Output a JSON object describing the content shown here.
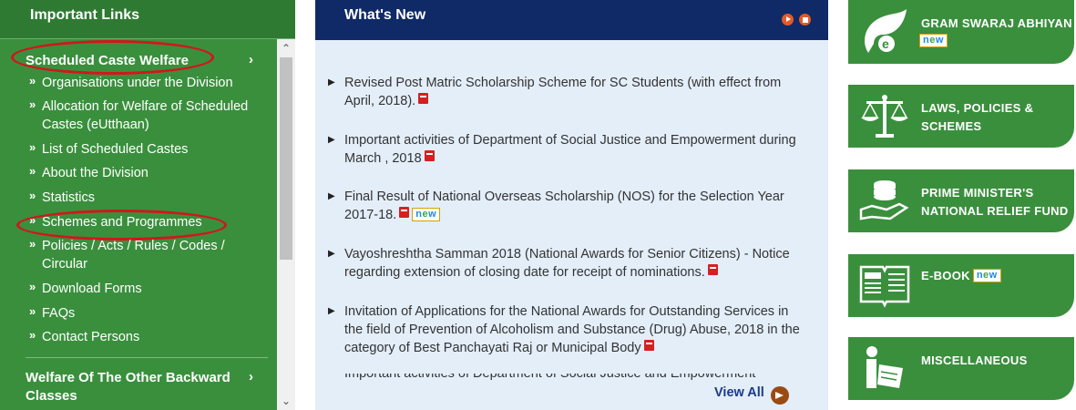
{
  "left_panel": {
    "title": "Important Links",
    "scroll_up": "⌃",
    "scroll_down": "⌄",
    "section1": {
      "label": "Scheduled Caste Welfare",
      "chevron": "›",
      "items": [
        {
          "label": "Organisations under the Division"
        },
        {
          "label": "Allocation for Welfare of Scheduled Castes (eUtthaan)"
        },
        {
          "label": "List of Scheduled Castes"
        },
        {
          "label": "About the Division"
        },
        {
          "label": "Statistics"
        },
        {
          "label": "Schemes and Programmes"
        },
        {
          "label": "Policies / Acts / Rules / Codes / Circular"
        },
        {
          "label": "Download Forms"
        },
        {
          "label": "FAQs"
        },
        {
          "label": "Contact Persons"
        }
      ]
    },
    "section2": {
      "label": "Welfare Of The Other Backward Classes",
      "chevron": "›"
    },
    "highlight_color": "#d2161c"
  },
  "whats_new": {
    "title": "What's New",
    "items": [
      {
        "text": "Revised Post Matric Scholarship Scheme for SC Students (with effect from April, 2018).",
        "pdf": true,
        "new": false
      },
      {
        "text": "Important activities of Department of Social Justice and Empowerment during March , 2018",
        "pdf": true,
        "new": false
      },
      {
        "text": "Final Result of National Overseas Scholarship (NOS) for the Selection Year 2017-18.",
        "pdf": true,
        "new": true
      },
      {
        "text": "Vayoshreshtha Samman 2018 (National Awards for Senior Citizens) - Notice regarding extension of closing date for receipt of nominations.",
        "pdf": true,
        "new": false
      },
      {
        "text": "Invitation of Applications for the National Awards for Outstanding Services in the field of Prevention of Alcoholism and Substance (Drug) Abuse, 2018 in the category of Best Panchayati Raj or Municipal Body",
        "pdf": true,
        "new": false
      },
      {
        "text": "Important activities of Department of Social Justice and Empowerment during",
        "pdf": false,
        "new": false
      }
    ],
    "new_badge": "new",
    "view_all": "View All"
  },
  "tiles": [
    {
      "label": "GRAM SWARAJ ABHIYAN",
      "new": true,
      "icon": "gram-swaraj-logo-icon"
    },
    {
      "label": "LAWS, POLICIES & SCHEMES",
      "new": false,
      "icon": "scales-icon"
    },
    {
      "label": "PRIME MINISTER'S NATIONAL RELIEF FUND",
      "new": false,
      "icon": "coins-hand-icon"
    },
    {
      "label": "E-BOOK",
      "new": true,
      "icon": "open-book-icon"
    },
    {
      "label": "MISCELLANEOUS",
      "new": false,
      "icon": "person-reading-icon"
    }
  ],
  "colors": {
    "green": "#3a8f3d",
    "navy": "#0f2a66",
    "light_blue": "#e3eef9",
    "red_oval": "#d2161c"
  }
}
